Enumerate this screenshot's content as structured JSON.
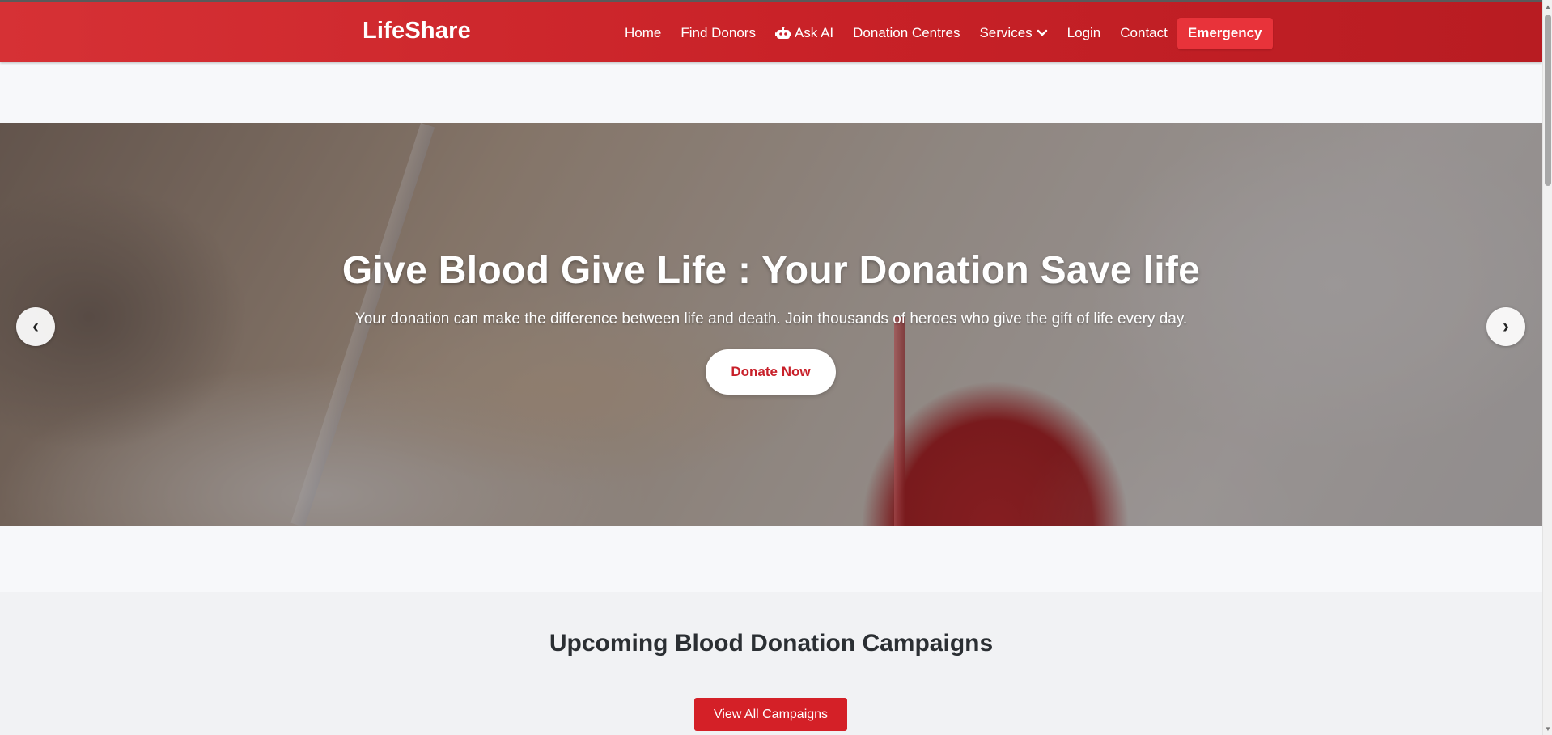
{
  "navbar": {
    "brand": "LifeShare",
    "links": [
      {
        "label": "Home"
      },
      {
        "label": "Find Donors"
      },
      {
        "label": "Ask AI",
        "icon": "robot-icon"
      },
      {
        "label": "Donation Centres"
      },
      {
        "label": "Services",
        "icon": "chevron-down-icon"
      },
      {
        "label": "Login"
      },
      {
        "label": "Contact"
      }
    ],
    "emergency_label": "Emergency"
  },
  "hero": {
    "title": "Give Blood Give Life : Your Donation Save life",
    "subtitle": "Your donation can make the difference between life and death. Join thousands of heroes who give the gift of life every day.",
    "cta_label": "Donate Now",
    "prev_label": "‹",
    "next_label": "›"
  },
  "campaigns": {
    "title": "Upcoming Blood Donation Campaigns",
    "view_all_label": "View All Campaigns"
  },
  "colors": {
    "brand_red": "#c8202a",
    "emergency_red": "#e8333a",
    "heading_dark": "#2b2f33"
  }
}
